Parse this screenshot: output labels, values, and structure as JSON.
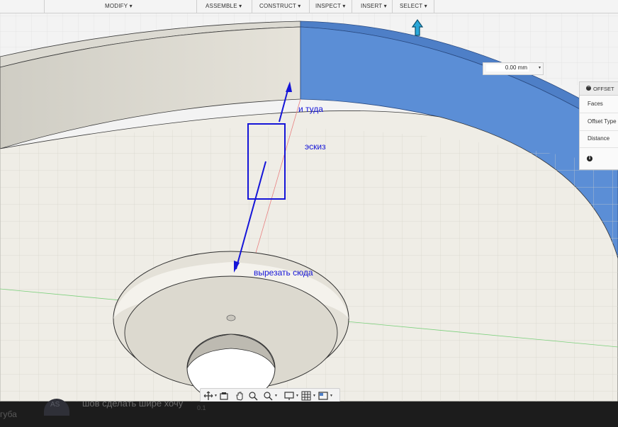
{
  "toolbar": {
    "menus": [
      {
        "label": "MODIFY ▾"
      },
      {
        "label": "ASSEMBLE ▾"
      },
      {
        "label": "CONSTRUCT ▾"
      },
      {
        "label": "INSPECT ▾"
      },
      {
        "label": "INSERT ▾"
      },
      {
        "label": "SELECT ▾"
      }
    ]
  },
  "distance_input": {
    "value": "0.00 mm",
    "caret": "▾"
  },
  "offset_panel": {
    "title": "OFFSET",
    "rows": [
      {
        "label": "Faces"
      },
      {
        "label": "Offset Type"
      },
      {
        "label": "Distance"
      }
    ],
    "info_icon": "i"
  },
  "annotations": {
    "there": "и туда",
    "sketch": "эскиз",
    "cut_here": "вырезать сюда"
  },
  "colors": {
    "annotation": "#1515d8",
    "selected_face": "#5b8ed6",
    "model_surface": "#efede6",
    "grid": "#d6d4cc",
    "x_axis": "#6cc46c",
    "y_axis": "#e07070"
  },
  "navbar": {
    "icons": [
      "orbit-icon",
      "look-at-icon",
      "pan-icon",
      "zoom-icon",
      "fit-icon",
      "display-settings-icon",
      "grid-settings-icon",
      "viewports-icon"
    ]
  },
  "chat_overlay": {
    "avatar_text": "AS",
    "message": "шов сделать шире хочу",
    "count": "0.1",
    "left_fragment": "губа"
  }
}
